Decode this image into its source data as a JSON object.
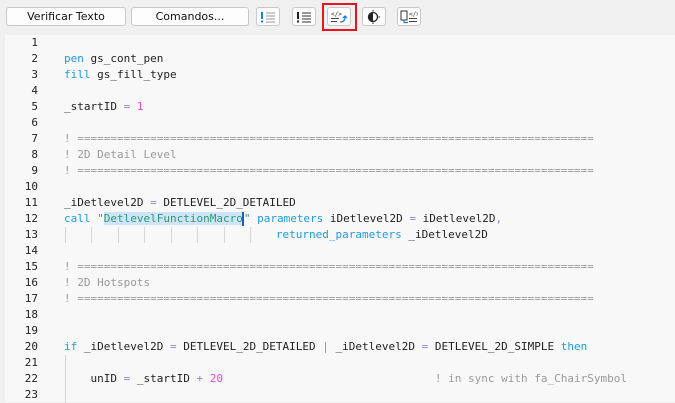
{
  "toolbar": {
    "verify_label": "Verificar Texto",
    "commands_label": "Comandos...",
    "icons": [
      "show-warnings-icon",
      "show-errors-icon",
      "insert-code-snippet-icon",
      "theme-toggle-icon",
      "copy-code-icon"
    ]
  },
  "colors": {
    "keyword": "#1e9be0",
    "string": "#2a9d6a",
    "number": "#e546e0",
    "comment": "#9a9a9a",
    "operator": "#9a7fd0",
    "highlight": "#e8141c"
  },
  "editor": {
    "lines": [
      {
        "n": "1",
        "seg": []
      },
      {
        "n": "2",
        "seg": [
          [
            "kw",
            "pen"
          ],
          [
            "txt",
            " gs_cont_pen"
          ]
        ]
      },
      {
        "n": "3",
        "seg": [
          [
            "kw",
            "fill"
          ],
          [
            "txt",
            " gs_fill_type"
          ]
        ]
      },
      {
        "n": "4",
        "seg": []
      },
      {
        "n": "5",
        "seg": [
          [
            "txt",
            "_startID "
          ],
          [
            "op",
            "="
          ],
          [
            "txt",
            " "
          ],
          [
            "num",
            "1"
          ]
        ]
      },
      {
        "n": "6",
        "seg": []
      },
      {
        "n": "7",
        "seg": [
          [
            "cmt",
            "! =============================================================================="
          ]
        ]
      },
      {
        "n": "8",
        "seg": [
          [
            "cmt",
            "! 2D Detail Level"
          ]
        ]
      },
      {
        "n": "9",
        "seg": [
          [
            "cmt",
            "! =============================================================================="
          ]
        ]
      },
      {
        "n": "10",
        "seg": []
      },
      {
        "n": "11",
        "seg": [
          [
            "txt",
            "_iDetlevel2D "
          ],
          [
            "op",
            "="
          ],
          [
            "txt",
            " DETLEVEL_2D_DETAILED"
          ]
        ]
      },
      {
        "n": "12",
        "seg": [
          [
            "kw",
            "call"
          ],
          [
            "txt",
            " "
          ],
          [
            "str",
            "\""
          ],
          [
            "str sel",
            "DetlevelFunctionMacro"
          ],
          [
            "caret",
            ""
          ],
          [
            "str",
            "\""
          ],
          [
            "txt",
            " "
          ],
          [
            "kw",
            "parameters"
          ],
          [
            "txt",
            " iDetlevel2D "
          ],
          [
            "op",
            "="
          ],
          [
            "txt",
            " iDetlevel2D"
          ],
          [
            "op",
            ","
          ]
        ]
      },
      {
        "n": "13",
        "seg": [
          [
            "txt",
            "                                "
          ],
          [
            "kw",
            "returned_parameters"
          ],
          [
            "txt",
            " _iDetlevel2D"
          ]
        ]
      },
      {
        "n": "14",
        "seg": []
      },
      {
        "n": "15",
        "seg": [
          [
            "cmt",
            "! =============================================================================="
          ]
        ]
      },
      {
        "n": "16",
        "seg": [
          [
            "cmt",
            "! 2D Hotspots"
          ]
        ]
      },
      {
        "n": "17",
        "seg": [
          [
            "cmt",
            "! =============================================================================="
          ]
        ]
      },
      {
        "n": "18",
        "seg": []
      },
      {
        "n": "19",
        "seg": []
      },
      {
        "n": "20",
        "seg": [
          [
            "kw",
            "if"
          ],
          [
            "txt",
            " _iDetlevel2D "
          ],
          [
            "op",
            "="
          ],
          [
            "txt",
            " DETLEVEL_2D_DETAILED "
          ],
          [
            "op",
            "|"
          ],
          [
            "txt",
            " _iDetlevel2D "
          ],
          [
            "op",
            "="
          ],
          [
            "txt",
            " DETLEVEL_2D_SIMPLE "
          ],
          [
            "kw",
            "then"
          ]
        ]
      },
      {
        "n": "21",
        "seg": []
      },
      {
        "n": "22",
        "seg": [
          [
            "txt",
            "    unID "
          ],
          [
            "op",
            "="
          ],
          [
            "txt",
            " _startID "
          ],
          [
            "op",
            "+"
          ],
          [
            "txt",
            " "
          ],
          [
            "num",
            "20"
          ],
          [
            "txt",
            "                                "
          ],
          [
            "cmt",
            "! in sync with fa_ChairSymbol"
          ]
        ]
      },
      {
        "n": "23",
        "seg": []
      }
    ]
  }
}
